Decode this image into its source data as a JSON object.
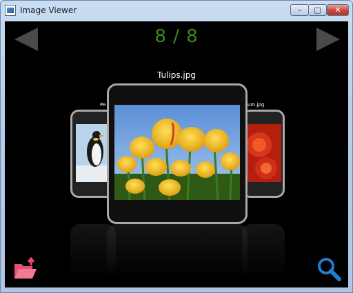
{
  "window": {
    "title": "Image Viewer",
    "minimize": "–",
    "maximize": "□",
    "close": "✕"
  },
  "viewer": {
    "counter": "8 / 8",
    "current_caption": "Tulips.jpg",
    "left_caption": "Pe",
    "right_caption": "um.jpg"
  },
  "icons": {
    "prev": "left-arrow-icon",
    "next": "right-arrow-icon",
    "open": "open-folder-icon",
    "zoom": "magnifier-icon"
  },
  "colors": {
    "counter": "#3c8a1c",
    "open_icon": "#e8506f",
    "zoom_icon": "#1f7fd0"
  }
}
